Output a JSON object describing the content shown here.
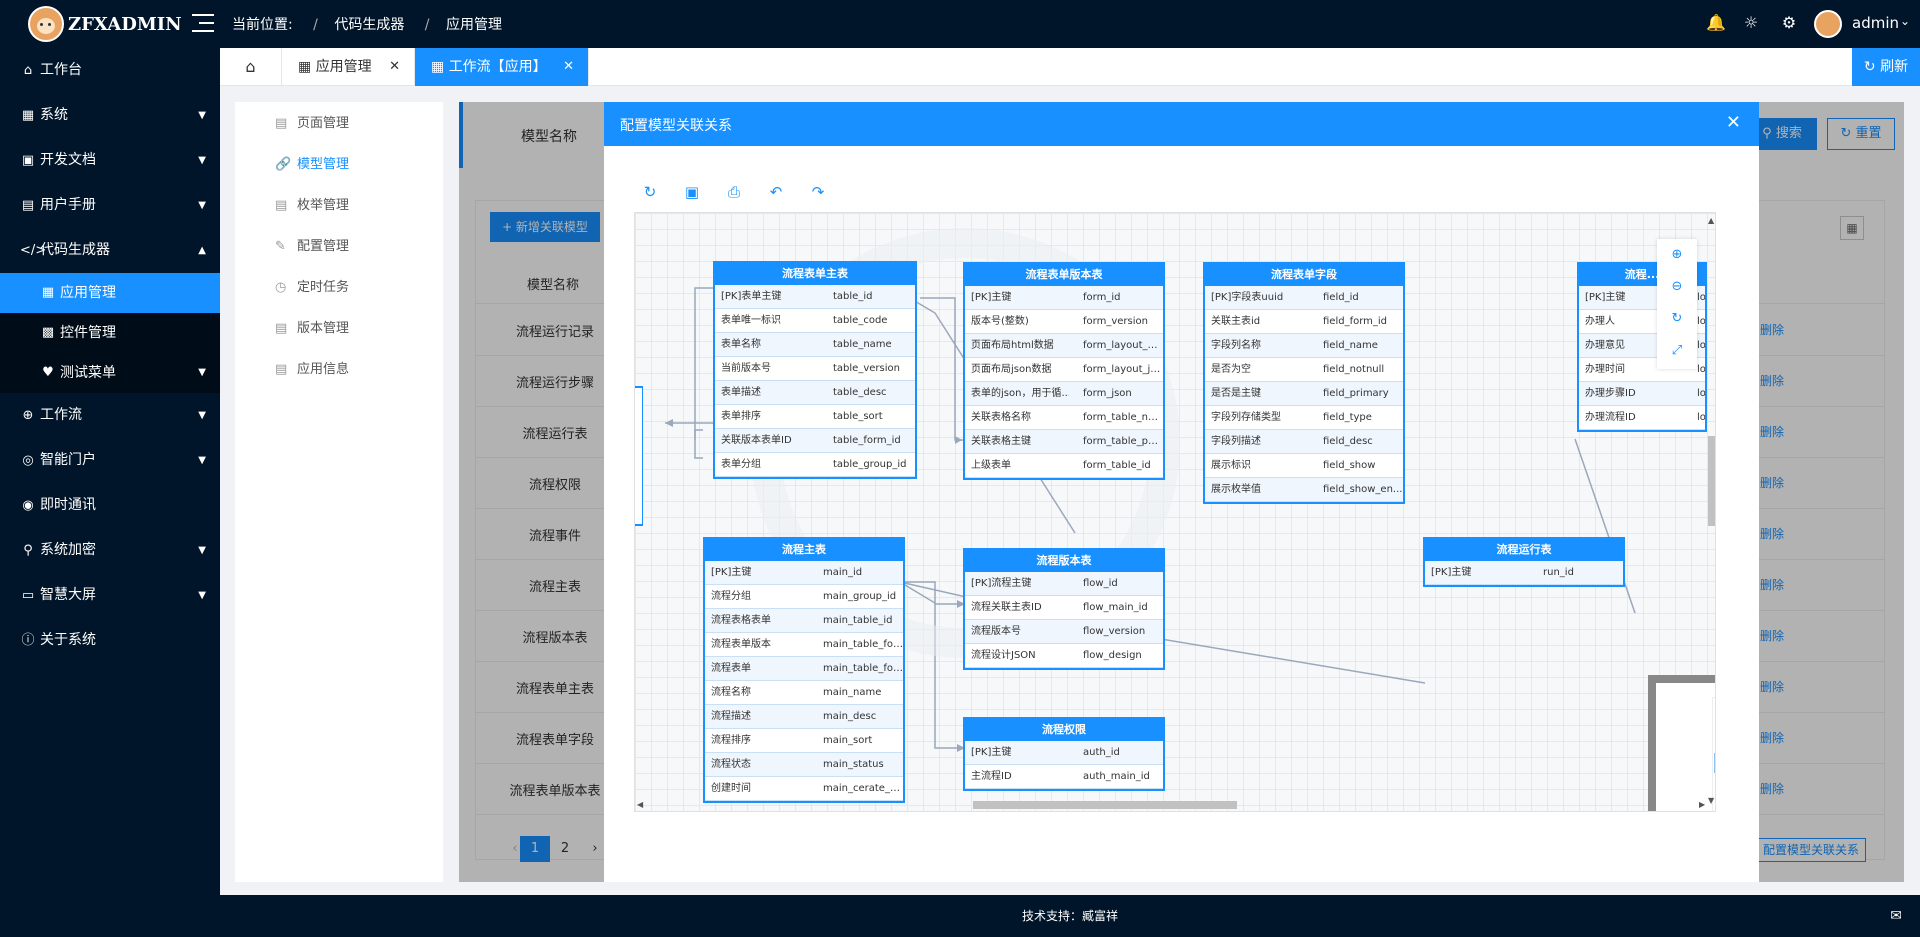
{
  "brand": {
    "name": "ZFXADMIN"
  },
  "header": {
    "location_label": "当前位置:",
    "breadcrumb": [
      "/",
      "代码生成器",
      "/",
      "应用管理"
    ],
    "user": "admin"
  },
  "sidebar": {
    "items": [
      {
        "label": "工作台",
        "icon": "home-icon"
      },
      {
        "label": "系统",
        "icon": "grid-icon"
      },
      {
        "label": "开发文档",
        "icon": "book-icon"
      },
      {
        "label": "用户手册",
        "icon": "doc-icon"
      },
      {
        "label": "代码生成器",
        "icon": "code-icon"
      },
      {
        "label": "工作流",
        "icon": "flow-icon"
      },
      {
        "label": "智能门户",
        "icon": "globe-icon"
      },
      {
        "label": "即时通讯",
        "icon": "chat-icon"
      },
      {
        "label": "系统加密",
        "icon": "lock-icon"
      },
      {
        "label": "智慧大屏",
        "icon": "screen-icon"
      },
      {
        "label": "关于系统",
        "icon": "info-icon"
      }
    ],
    "sub": [
      {
        "label": "应用管理"
      },
      {
        "label": "控件管理"
      },
      {
        "label": "测试菜单"
      }
    ]
  },
  "tabs": [
    {
      "label": "应用管理"
    },
    {
      "label": "工作流【应用】"
    }
  ],
  "refresh_label": "刷新",
  "left_menu": [
    {
      "label": "页面管理"
    },
    {
      "label": "模型管理"
    },
    {
      "label": "枚举管理"
    },
    {
      "label": "配置管理"
    },
    {
      "label": "定时任务"
    },
    {
      "label": "版本管理"
    },
    {
      "label": "应用信息"
    }
  ],
  "search": {
    "label": "模型名称",
    "search_btn": "搜索",
    "reset_btn": "重置",
    "add_btn": "+ 新增关联模型"
  },
  "table": {
    "header": "模型名称",
    "rows": [
      "流程运行记录",
      "流程运行步骤",
      "流程运行表",
      "流程权限",
      "流程事件",
      "流程主表",
      "流程版本表",
      "流程表单主表",
      "流程表单字段",
      "流程表单版本表"
    ],
    "delete_label": "删除",
    "relation_btn": "配置模型关联关系",
    "pages": [
      "1",
      "2"
    ]
  },
  "modal": {
    "title": "配置模型关联关系",
    "entities": [
      {
        "title": "流程表单主表",
        "rows": [
          [
            "[PK]表单主键",
            "table_id"
          ],
          [
            "表单唯一标识",
            "table_code"
          ],
          [
            "表单名称",
            "table_name"
          ],
          [
            "当前版本号",
            "table_version"
          ],
          [
            "表单描述",
            "table_desc"
          ],
          [
            "表单排序",
            "table_sort"
          ],
          [
            "关联版本表单ID",
            "table_form_id"
          ],
          [
            "表单分组",
            "table_group_id"
          ]
        ]
      },
      {
        "title": "流程表单版本表",
        "rows": [
          [
            "[PK]主键",
            "form_id"
          ],
          [
            "版本号(整数)",
            "form_version"
          ],
          [
            "页面布局html数据",
            "form_layout_ht..."
          ],
          [
            "页面布局json数据",
            "form_layout_js..."
          ],
          [
            "表单的json，用于循...",
            "form_json"
          ],
          [
            "关联表格名称",
            "form_table_na..."
          ],
          [
            "关联表格主键",
            "form_table_pk..."
          ],
          [
            "上级表单",
            "form_table_id"
          ]
        ]
      },
      {
        "title": "流程表单字段",
        "rows": [
          [
            "[PK]字段表uuid",
            "field_id"
          ],
          [
            "关联主表id",
            "field_form_id"
          ],
          [
            "字段列名称",
            "field_name"
          ],
          [
            "是否为空",
            "field_notnull"
          ],
          [
            "是否是主键",
            "field_primary"
          ],
          [
            "字段列存储类型",
            "field_type"
          ],
          [
            "字段列描述",
            "field_desc"
          ],
          [
            "展示标识",
            "field_show"
          ],
          [
            "展示枚举值",
            "field_show_en..."
          ]
        ]
      },
      {
        "title": "流程...",
        "rows": [
          [
            "[PK]主键",
            "lo"
          ],
          [
            "办理人",
            "lo"
          ],
          [
            "办理意见",
            "lo"
          ],
          [
            "办理时间",
            "lo"
          ],
          [
            "办理步骤ID",
            "lo"
          ],
          [
            "办理流程ID",
            "lo"
          ]
        ]
      },
      {
        "title": "流程主表",
        "rows": [
          [
            "[PK]主键",
            "main_id"
          ],
          [
            "流程分组",
            "main_group_id"
          ],
          [
            "流程表格表单",
            "main_table_id"
          ],
          [
            "流程表单版本",
            "main_table_for..."
          ],
          [
            "流程表单",
            "main_table_for..."
          ],
          [
            "流程名称",
            "main_name"
          ],
          [
            "流程描述",
            "main_desc"
          ],
          [
            "流程排序",
            "main_sort"
          ],
          [
            "流程状态",
            "main_status"
          ],
          [
            "创建时间",
            "main_cerate_ti..."
          ]
        ]
      },
      {
        "title": "流程版本表",
        "rows": [
          [
            "[PK]流程主键",
            "flow_id"
          ],
          [
            "流程关联主表ID",
            "flow_main_id"
          ],
          [
            "流程版本号",
            "flow_version"
          ],
          [
            "流程设计JSON",
            "flow_design"
          ]
        ]
      },
      {
        "title": "流程权限",
        "rows": [
          [
            "[PK]主键",
            "auth_id"
          ],
          [
            "主流程ID",
            "auth_main_id"
          ]
        ]
      },
      {
        "title": "流程运行表",
        "rows": [
          [
            "[PK]主键",
            "run_id"
          ]
        ]
      }
    ]
  },
  "footer": "技术支持：臧富祥"
}
